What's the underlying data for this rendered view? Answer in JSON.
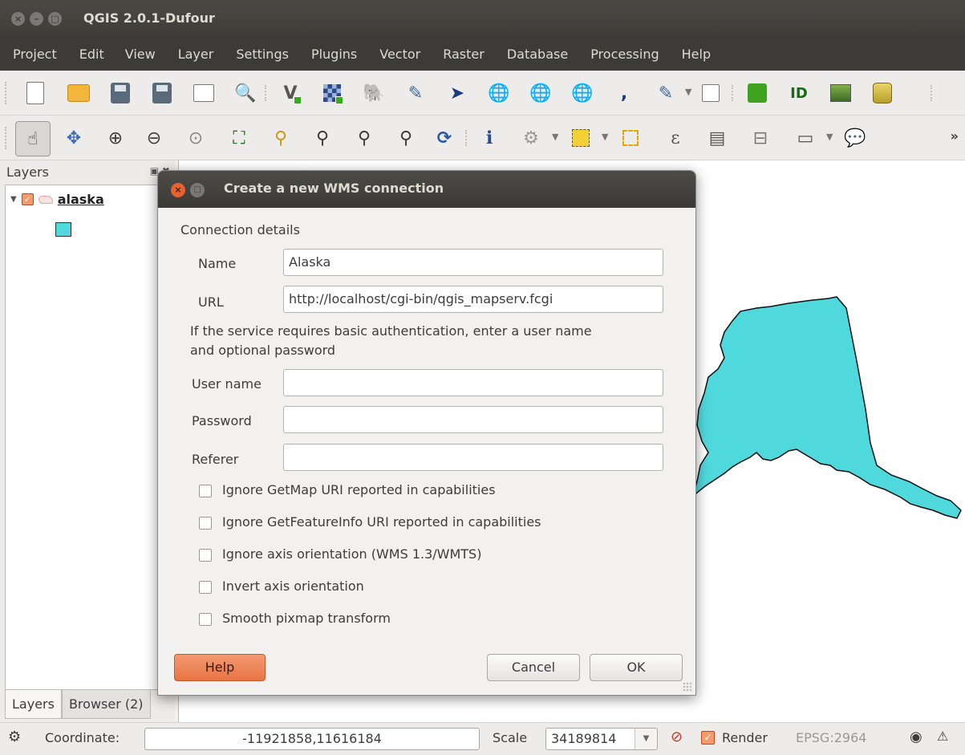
{
  "window": {
    "title": "QGIS 2.0.1-Dufour"
  },
  "menu": [
    "Project",
    "Edit",
    "View",
    "Layer",
    "Settings",
    "Plugins",
    "Vector",
    "Raster",
    "Database",
    "Processing",
    "Help"
  ],
  "toolbar1_icons": [
    "new-project-icon",
    "open-project-icon",
    "save-project-icon",
    "save-as-icon",
    "new-print-composer-icon",
    "composer-manager-icon",
    "add-vector-layer-icon",
    "add-raster-layer-icon",
    "add-postgis-layer-icon",
    "add-spatialite-layer-icon",
    "add-mssql-layer-icon",
    "add-wms-layer-icon",
    "add-wcs-layer-icon",
    "add-wfs-layer-icon",
    "add-delimited-text-icon",
    "new-shapefile-icon",
    "new-spatialite-icon",
    "grass-icon",
    "openstreetmap-icon",
    "georeferencer-icon",
    "db-manager-icon"
  ],
  "toolbar2_icons": [
    "pan-icon",
    "pan-to-selection-icon",
    "zoom-in-icon",
    "zoom-out-icon",
    "zoom-native-icon",
    "zoom-full-icon",
    "zoom-to-selection-icon",
    "zoom-to-layer-icon",
    "zoom-last-icon",
    "zoom-next-icon",
    "refresh-icon",
    "identify-icon",
    "run-feature-action-icon",
    "select-features-icon",
    "deselect-icon",
    "select-by-expression-icon",
    "attribute-table-icon",
    "field-calculator-icon",
    "measure-icon",
    "map-tips-icon"
  ],
  "layers_panel": {
    "title": "Layers",
    "layer_name": "alaska",
    "symbol_color": "#50d9dc",
    "tabs": [
      "Layers",
      "Browser (2)"
    ]
  },
  "map": {
    "fill_color": "#50d9dc"
  },
  "status": {
    "coordinate_label": "Coordinate:",
    "coordinate_value": "-11921858,11616184",
    "scale_label": "Scale",
    "scale_value": "34189814",
    "render_label": "Render",
    "crs": "EPSG:2964"
  },
  "dialog": {
    "title": "Create a new WMS connection",
    "section": "Connection details",
    "name_label": "Name",
    "name_value": "Alaska",
    "url_label": "URL",
    "url_value": "http://localhost/cgi-bin/qgis_mapserv.fcgi",
    "auth_note_line1": "If the service requires basic authentication, enter a user name",
    "auth_note_line2": "and optional password",
    "username_label": "User name",
    "username_value": "",
    "password_label": "Password",
    "password_value": "",
    "referer_label": "Referer",
    "referer_value": "",
    "checkboxes": [
      "Ignore GetMap URI reported in capabilities",
      "Ignore GetFeatureInfo URI reported in capabilities",
      "Ignore axis orientation (WMS 1.3/WMTS)",
      "Invert axis orientation",
      "Smooth pixmap transform"
    ],
    "help_label": "Help",
    "cancel_label": "Cancel",
    "ok_label": "OK"
  }
}
